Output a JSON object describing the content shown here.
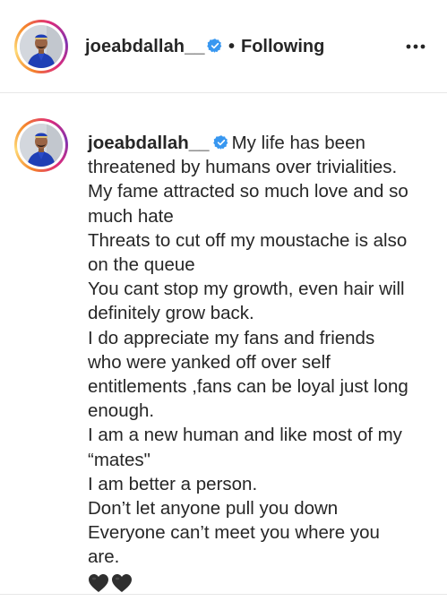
{
  "header": {
    "username": "joeabdallah__",
    "verified_icon": "verified-badge-icon",
    "separator": "•",
    "follow_status": "Following",
    "more_icon": "more-options-icon"
  },
  "caption": {
    "username": "joeabdallah__",
    "verified_icon": "verified-badge-icon",
    "lines": [
      "My life has been",
      "threatened by humans over trivialities.",
      "My fame attracted so much love and so",
      "much hate",
      "Threats to cut off my moustache is also",
      "on the queue",
      "You cant stop my growth, even hair will",
      "definitely grow back.",
      "I do appreciate my fans and friends",
      "who were yanked off over self",
      "entitlements ,fans can be loyal just long",
      "enough.",
      "I am a new human and like most of my",
      "“mates\"",
      "I am better a person.",
      "Don’t let anyone pull you down",
      "Everyone can’t meet you where you",
      "are."
    ],
    "emoji": [
      "black-heart-icon",
      "black-heart-icon"
    ]
  },
  "colors": {
    "text": "#262626",
    "verified_blue": "#3897f0",
    "divider": "#e7e7e7",
    "story_ring_start": "#f58529",
    "story_ring_end": "#dd2a7b"
  }
}
